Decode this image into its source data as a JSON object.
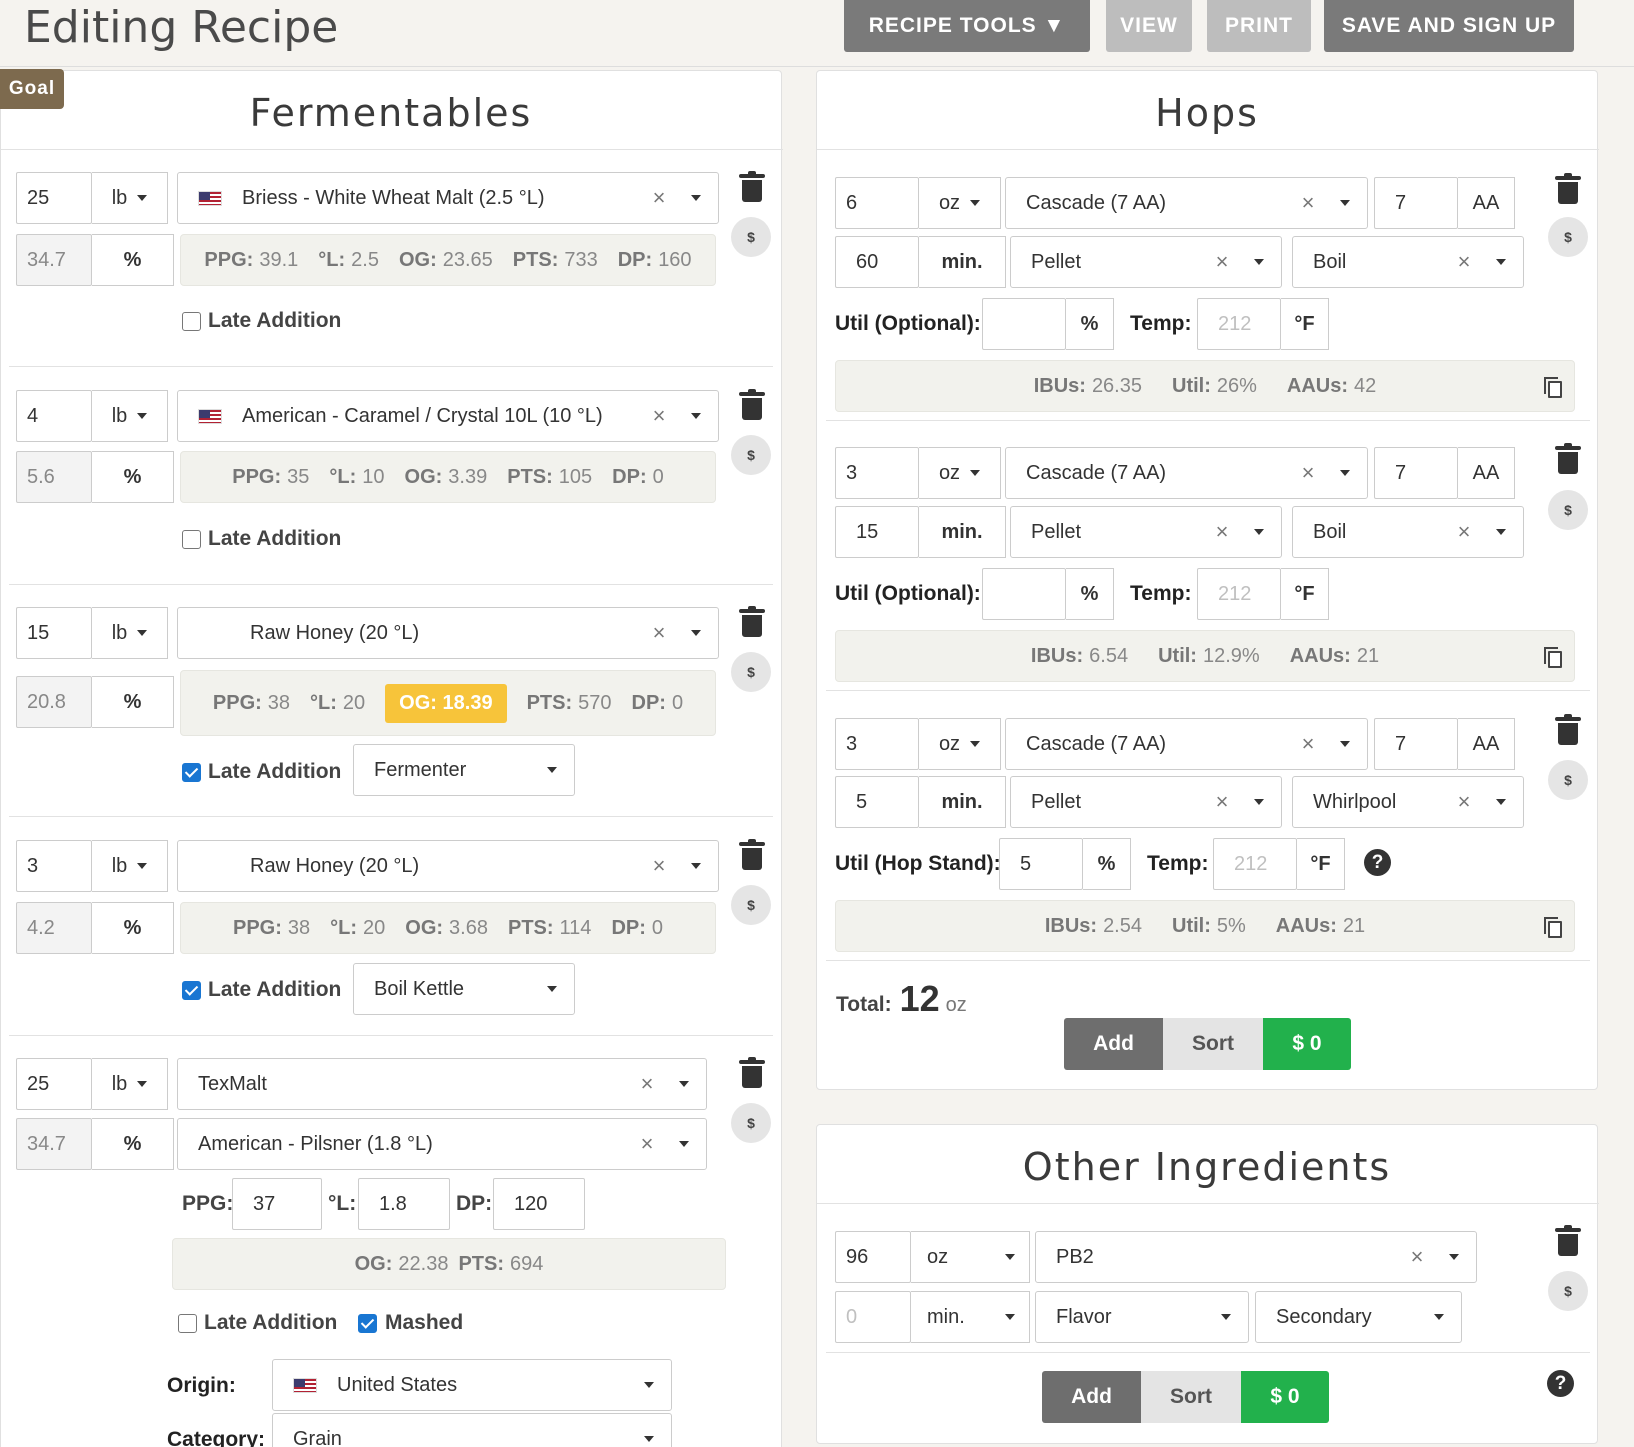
{
  "header": {
    "title": "Editing Recipe",
    "recipe_tools": "RECIPE TOOLS ▼",
    "view": "VIEW",
    "print": "PRINT",
    "save": "SAVE AND SIGN UP"
  },
  "goal_tab": "Goal",
  "fermentables": {
    "title": "Fermentables",
    "late_label": "Late Addition",
    "items": [
      {
        "amount": "25",
        "unit": "lb",
        "name": "Briess - White Wheat Malt (2.5 °L)",
        "pct": "34.7",
        "pct_unit": "%",
        "ppg": "39.1",
        "l": "2.5",
        "og": "23.65",
        "pts": "733",
        "dp": "160",
        "late": false
      },
      {
        "amount": "4",
        "unit": "lb",
        "name": "American - Caramel / Crystal 10L (10 °L)",
        "pct": "5.6",
        "pct_unit": "%",
        "ppg": "35",
        "l": "10",
        "og": "3.39",
        "pts": "105",
        "dp": "0",
        "late": false
      },
      {
        "amount": "15",
        "unit": "lb",
        "name": "Raw Honey (20 °L)",
        "pct": "20.8",
        "pct_unit": "%",
        "ppg": "38",
        "l": "20",
        "og": "18.39",
        "pts": "570",
        "dp": "0",
        "late": true,
        "late_where": "Fermenter"
      },
      {
        "amount": "3",
        "unit": "lb",
        "name": "Raw Honey (20 °L)",
        "pct": "4.2",
        "pct_unit": "%",
        "ppg": "38",
        "l": "20",
        "og": "3.68",
        "pts": "114",
        "dp": "0",
        "late": true,
        "late_where": "Boil Kettle"
      },
      {
        "amount": "25",
        "unit": "lb",
        "name": "TexMalt",
        "base": "American - Pilsner (1.8 °L)",
        "pct": "34.7",
        "pct_unit": "%",
        "ppg": "37",
        "l": "1.8",
        "dp": "120",
        "og": "22.38",
        "pts": "694",
        "late": false,
        "mashed": true,
        "mashed_label": "Mashed",
        "origin_label": "Origin:",
        "origin": "United States",
        "category_label": "Category:",
        "category": "Grain"
      }
    ],
    "labels": {
      "ppg": "PPG:",
      "l": "°L:",
      "og": "OG:",
      "pts": "PTS:",
      "dp": "DP:"
    }
  },
  "hops": {
    "title": "Hops",
    "labels": {
      "aa": "AA",
      "min": "min.",
      "util_opt": "Util (Optional):",
      "util_stand": "Util (Hop Stand):",
      "pct": "%",
      "temp": "Temp:",
      "temp_unit": "°F",
      "temp_ph": "212",
      "ibus": "IBUs:",
      "util": "Util:",
      "aaus": "AAUs:"
    },
    "items": [
      {
        "amount": "6",
        "unit": "oz",
        "name": "Cascade (7 AA)",
        "aa": "7",
        "time": "60",
        "form": "Pellet",
        "use": "Boil",
        "util": "",
        "ibus": "26.35",
        "util_pct": "26%",
        "aaus": "42"
      },
      {
        "amount": "3",
        "unit": "oz",
        "name": "Cascade (7 AA)",
        "aa": "7",
        "time": "15",
        "form": "Pellet",
        "use": "Boil",
        "util": "",
        "ibus": "6.54",
        "util_pct": "12.9%",
        "aaus": "21"
      },
      {
        "amount": "3",
        "unit": "oz",
        "name": "Cascade (7 AA)",
        "aa": "7",
        "time": "5",
        "form": "Pellet",
        "use": "Whirlpool",
        "util": "5",
        "ibus": "2.54",
        "util_pct": "5%",
        "aaus": "21"
      }
    ],
    "total_label": "Total:",
    "total": "12",
    "total_unit": "oz",
    "add": "Add",
    "sort": "Sort",
    "cost": "$ 0"
  },
  "other": {
    "title": "Other Ingredients",
    "amount": "96",
    "unit": "oz",
    "name": "PB2",
    "time_ph": "0",
    "time_unit": "min.",
    "type": "Flavor",
    "use": "Secondary",
    "add": "Add",
    "sort": "Sort",
    "cost": "$ 0"
  },
  "colors": {
    "highlight": "#f7c43a",
    "green": "#22b14c",
    "check": "#1976d2",
    "goal": "#7d6a4e"
  }
}
